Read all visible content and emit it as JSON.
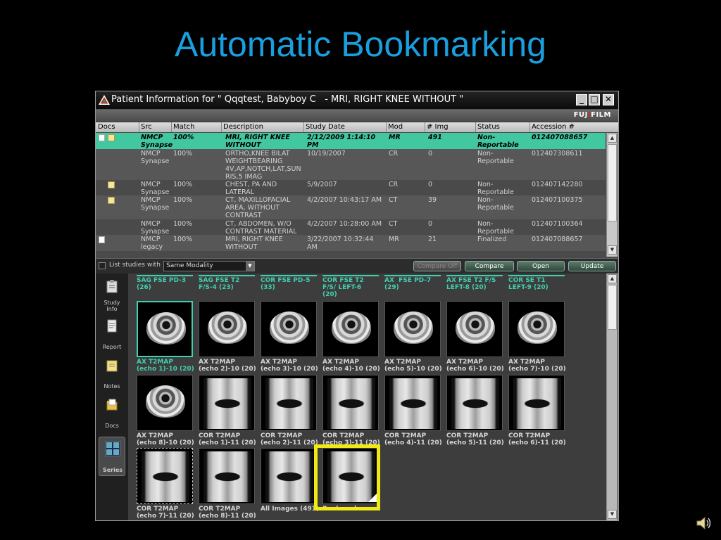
{
  "slide": {
    "title": "Automatic Bookmarking"
  },
  "window": {
    "title": "Patient Information for \" Qqqtest, Babyboy C   - MRI, RIGHT KNEE WITHOUT \"",
    "brand": {
      "prefix": "FUJ",
      "mid": "I",
      "suffix": "FILM"
    },
    "controls": {
      "minimize": "_",
      "maximize": "□",
      "close": "✕"
    }
  },
  "grid": {
    "columns": [
      "Docs",
      "Src",
      "Match",
      "Description",
      "Study Date",
      "Mod",
      "# Img",
      "Status",
      "Accession #"
    ],
    "rows": [
      {
        "src": "NMCP\nSynapse",
        "match": "100%",
        "desc": "MRI, RIGHT KNEE\nWITHOUT",
        "date": "2/12/2009 1:14:10\nPM",
        "mod": "MR",
        "img": "491",
        "status": "Non-\nReportable",
        "acc": "012407088657",
        "icons": "doc+note"
      },
      {
        "src": "NMCP\nSynapse",
        "match": "100%",
        "desc": "ORTHO,KNEE BILAT\nWEIGHTBEARING\n4V,AP,NOTCH,LAT,SUN\nRIS,5 IMAG",
        "date": "10/19/2007",
        "mod": "CR",
        "img": "0",
        "status": "Non-\nReportable",
        "acc": "012407308611",
        "icons": ""
      },
      {
        "src": "NMCP\nSynapse",
        "match": "100%",
        "desc": "CHEST, PA AND\nLATERAL",
        "date": "5/9/2007",
        "mod": "CR",
        "img": "0",
        "status": "Non-\nReportable",
        "acc": "012407142280",
        "icons": "note"
      },
      {
        "src": "NMCP\nSynapse",
        "match": "100%",
        "desc": "CT, MAXILLOFACIAL\nAREA, WITHOUT\nCONTRAST",
        "date": "4/2/2007 10:43:17 AM",
        "mod": "CT",
        "img": "39",
        "status": "Non-\nReportable",
        "acc": "012407100375",
        "icons": "note"
      },
      {
        "src": "NMCP\nSynapse",
        "match": "100%",
        "desc": "CT, ABDOMEN, W/O\nCONTRAST MATERIAL",
        "date": "4/2/2007 10:28:00 AM",
        "mod": "CT",
        "img": "0",
        "status": "Non-\nReportable",
        "acc": "012407100364",
        "icons": ""
      },
      {
        "src": "NMCP\nlegacy",
        "match": "100%",
        "desc": "MRI, RIGHT KNEE\nWITHOUT",
        "date": "3/22/2007 10:32:44\nAM",
        "mod": "MR",
        "img": "21",
        "status": "Finalized",
        "acc": "012407088657",
        "icons": "doc"
      }
    ]
  },
  "controls": {
    "list_label": "List studies with",
    "modality_value": "Same Modality",
    "compare_off": "Compare Off",
    "compare": "Compare",
    "open": "Open",
    "update": "Update"
  },
  "sidebar": {
    "study_info": "Study\nInfo",
    "report": "Report",
    "notes": "Notes",
    "docs": "Docs",
    "series": "Series"
  },
  "series": {
    "top_labels": [
      "SAG FSE PD-3\n(26)",
      "SAG FSE T2\nF/S-4 (23)",
      "COR FSE PD-5\n(33)",
      "COR FSE T2\nF/S/ LEFT-6\n(20)",
      "AX  FSE PD-7\n(29)",
      "AX FSE T2 F/S\nLEFT-8 (20)",
      "COR SE T1\nLEFT-9 (20)"
    ],
    "row1": [
      "AX T2MAP\n(echo 1)-10 (20)",
      "AX T2MAP\n(echo 2)-10 (20)",
      "AX T2MAP\n(echo 3)-10 (20)",
      "AX T2MAP\n(echo 4)-10 (20)",
      "AX T2MAP\n(echo 5)-10 (20)",
      "AX T2MAP\n(echo 6)-10 (20)",
      "AX T2MAP\n(echo 7)-10 (20)"
    ],
    "row2": [
      "AX T2MAP\n(echo 8)-10 (20)",
      "COR T2MAP\n(echo 1)-11 (20)",
      "COR T2MAP\n(echo 2)-11 (20)",
      "COR T2MAP\n(echo 3)-11 (20)",
      "COR T2MAP\n(echo 4)-11 (20)",
      "COR T2MAP\n(echo 5)-11 (20)",
      "COR T2MAP\n(echo 6)-11 (20)"
    ],
    "row3": [
      "COR T2MAP\n(echo 7)-11 (20)",
      "COR T2MAP\n(echo 8)-11 (20)",
      "All Images (491)",
      "Bookmarks"
    ]
  },
  "colors": {
    "title": "#1a9fde",
    "selected_row": "#42c8a0",
    "highlight": "#f0ea12",
    "teal_text": "#3fd0b0"
  }
}
